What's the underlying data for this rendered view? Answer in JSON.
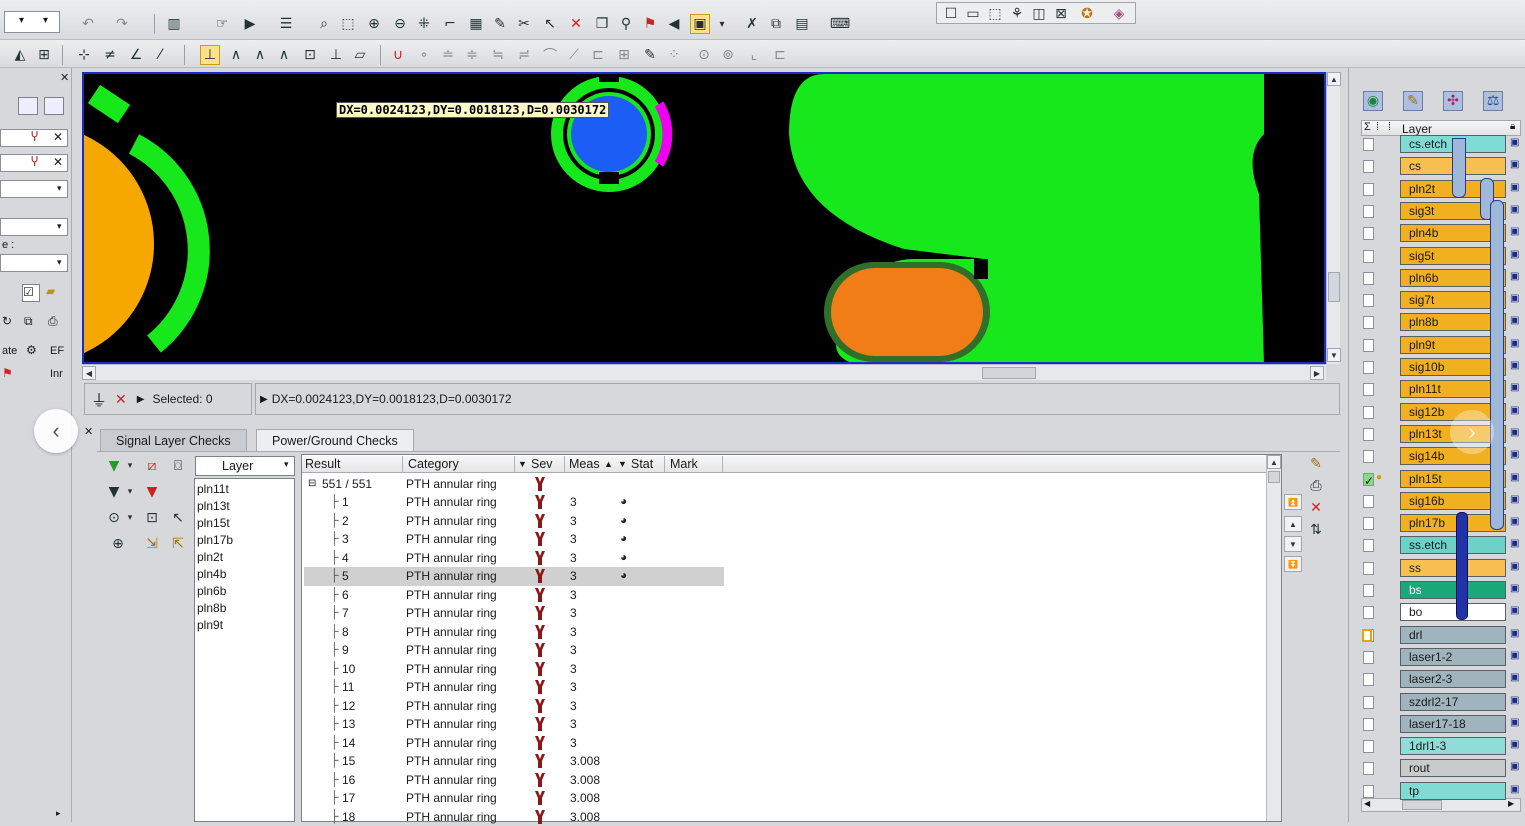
{
  "canvas": {
    "measure_label": "DX=0.0024123,DY=0.0018123,D=0.0030172",
    "colors": {
      "background": "#000000",
      "copper": "#17e81c",
      "pad_orange": "#f07d16",
      "pad_yellow": "#f7a800",
      "via": "#1c5ef5",
      "magenta": "#f000f0"
    }
  },
  "status": {
    "selected_label": "Selected: 0",
    "measure_readout": "DX=0.0024123,DY=0.0018123,D=0.0030172"
  },
  "left_strip": {
    "text_ate": "ate",
    "text_ef": "EF",
    "text_inr": "Inr",
    "text_e": "e :"
  },
  "tabs": [
    {
      "label": "Signal Layer Checks",
      "active": false
    },
    {
      "label": "Power/Ground Checks",
      "active": true
    }
  ],
  "filter": {
    "dropdown_label": "Layer",
    "layers": [
      "pln11t",
      "pln13t",
      "pln15t",
      "pln17b",
      "pln2t",
      "pln4b",
      "pln6b",
      "pln8b",
      "pln9t"
    ]
  },
  "results": {
    "columns": {
      "result": "Result",
      "category": "Category",
      "sev": "Sev",
      "meas": "Meas",
      "stat": "Stat",
      "mark": "Mark"
    },
    "root": {
      "label": "551 / 551",
      "category": "PTH annular ring"
    },
    "rows": [
      {
        "id": "1",
        "category": "PTH annular ring",
        "meas": "3",
        "stat": true,
        "selected": false
      },
      {
        "id": "2",
        "category": "PTH annular ring",
        "meas": "3",
        "stat": true,
        "selected": false
      },
      {
        "id": "3",
        "category": "PTH annular ring",
        "meas": "3",
        "stat": true,
        "selected": false
      },
      {
        "id": "4",
        "category": "PTH annular ring",
        "meas": "3",
        "stat": true,
        "selected": false
      },
      {
        "id": "5",
        "category": "PTH annular ring",
        "meas": "3",
        "stat": true,
        "selected": true
      },
      {
        "id": "6",
        "category": "PTH annular ring",
        "meas": "3",
        "stat": false,
        "selected": false
      },
      {
        "id": "7",
        "category": "PTH annular ring",
        "meas": "3",
        "stat": false,
        "selected": false
      },
      {
        "id": "8",
        "category": "PTH annular ring",
        "meas": "3",
        "stat": false,
        "selected": false
      },
      {
        "id": "9",
        "category": "PTH annular ring",
        "meas": "3",
        "stat": false,
        "selected": false
      },
      {
        "id": "10",
        "category": "PTH annular ring",
        "meas": "3",
        "stat": false,
        "selected": false
      },
      {
        "id": "11",
        "category": "PTH annular ring",
        "meas": "3",
        "stat": false,
        "selected": false
      },
      {
        "id": "12",
        "category": "PTH annular ring",
        "meas": "3",
        "stat": false,
        "selected": false
      },
      {
        "id": "13",
        "category": "PTH annular ring",
        "meas": "3",
        "stat": false,
        "selected": false
      },
      {
        "id": "14",
        "category": "PTH annular ring",
        "meas": "3",
        "stat": false,
        "selected": false
      },
      {
        "id": "15",
        "category": "PTH annular ring",
        "meas": "3.008",
        "stat": false,
        "selected": false
      },
      {
        "id": "16",
        "category": "PTH annular ring",
        "meas": "3.008",
        "stat": false,
        "selected": false
      },
      {
        "id": "17",
        "category": "PTH annular ring",
        "meas": "3.008",
        "stat": false,
        "selected": false
      },
      {
        "id": "18",
        "category": "PTH annular ring",
        "meas": "3.008",
        "stat": false,
        "selected": false
      }
    ]
  },
  "layer_panel": {
    "header": "Layer",
    "layers": [
      {
        "name": "cs.etch",
        "color": "#7fdcd4",
        "checked": false
      },
      {
        "name": "cs",
        "color": "#f8c050",
        "checked": false
      },
      {
        "name": "pln2t",
        "color": "#f0b020",
        "checked": false
      },
      {
        "name": "sig3t",
        "color": "#f0b020",
        "checked": false
      },
      {
        "name": "pln4b",
        "color": "#f0b020",
        "checked": false
      },
      {
        "name": "sig5t",
        "color": "#f0b020",
        "checked": false
      },
      {
        "name": "pln6b",
        "color": "#f0b020",
        "checked": false
      },
      {
        "name": "sig7t",
        "color": "#f0b020",
        "checked": false
      },
      {
        "name": "pln8b",
        "color": "#f0b020",
        "checked": false
      },
      {
        "name": "pln9t",
        "color": "#f0b020",
        "checked": false
      },
      {
        "name": "sig10b",
        "color": "#f0b020",
        "checked": false
      },
      {
        "name": "pln11t",
        "color": "#f0b020",
        "checked": false
      },
      {
        "name": "sig12b",
        "color": "#f0b020",
        "checked": false
      },
      {
        "name": "pln13t",
        "color": "#f0b020",
        "checked": false
      },
      {
        "name": "sig14b",
        "color": "#f0b020",
        "checked": false
      },
      {
        "name": "pln15t",
        "color": "#f0b020",
        "checked": true
      },
      {
        "name": "sig16b",
        "color": "#f0b020",
        "checked": false
      },
      {
        "name": "pln17b",
        "color": "#f0b020",
        "checked": false
      },
      {
        "name": "ss.etch",
        "color": "#6fd0c8",
        "checked": false
      },
      {
        "name": "ss",
        "color": "#f8c050",
        "checked": false
      },
      {
        "name": "bs",
        "color": "#1aa878",
        "checked": false
      },
      {
        "name": "bo",
        "color": "#ffffff",
        "checked": false
      },
      {
        "name": "drl",
        "color": "#9fb4bc",
        "checked": false
      },
      {
        "name": "laser1-2",
        "color": "#9fb4bc",
        "checked": false
      },
      {
        "name": "laser2-3",
        "color": "#9fb4bc",
        "checked": false
      },
      {
        "name": "szdrl2-17",
        "color": "#9fb4bc",
        "checked": false
      },
      {
        "name": "laser17-18",
        "color": "#9fb4bc",
        "checked": false
      },
      {
        "name": "1drl1-3",
        "color": "#8fdcd8",
        "checked": false
      },
      {
        "name": "rout",
        "color": "#c8cacc",
        "checked": false
      },
      {
        "name": "tp",
        "color": "#7fdcd4",
        "checked": false
      }
    ]
  }
}
